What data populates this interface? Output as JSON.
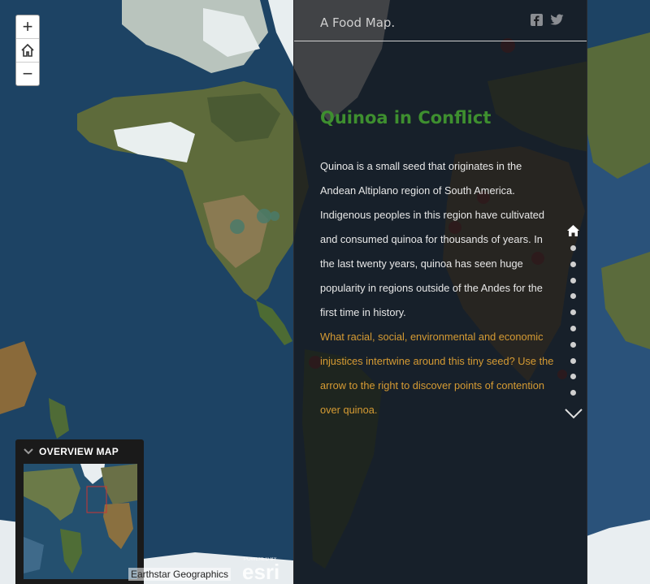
{
  "app": {
    "brand": "A Food Map."
  },
  "map_controls": {
    "zoom_in_label": "+",
    "home_icon": "home-icon",
    "zoom_out_label": "−"
  },
  "social": {
    "facebook_icon": "facebook-icon",
    "twitter_icon": "twitter-icon"
  },
  "story": {
    "title": "Quinoa in Conflict",
    "body": "Quinoa is a small seed that originates in the Andean Altiplano region of South America. Indigenous peoples in this region have cultivated and consumed quinoa for thousands of years. In the last twenty years, quinoa has seen huge popularity in regions outside of the Andes for the first time in history.",
    "question": "What racial, social, environmental and economic injustices intertwine around this tiny seed? Use the arrow to the right to discover points of contention over quinoa.",
    "title_color": "#3e8f2f",
    "question_color": "#d69b33"
  },
  "story_nav": {
    "home_icon": "home-icon",
    "section_count": 10,
    "next_icon": "chevron-down-icon"
  },
  "overview": {
    "title": "OVERVIEW MAP",
    "toggle_icon": "chevron-down-icon"
  },
  "attribution": {
    "text": "Earthstar Geographics",
    "logo_powered": "POWERED BY",
    "logo": "esri"
  }
}
